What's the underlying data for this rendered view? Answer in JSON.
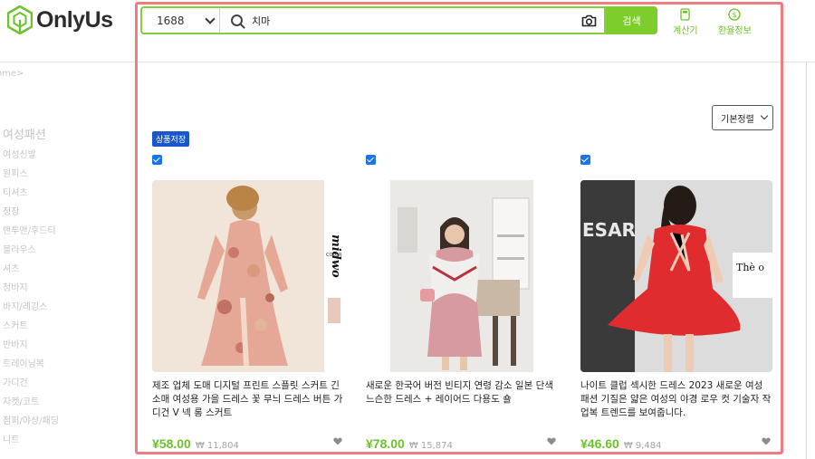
{
  "header": {
    "logo_text": "OnlyUs",
    "site_select": "1688",
    "search_value": "치마",
    "search_button": "검색",
    "tools": {
      "calculator": "계산기",
      "exchange": "환율정보"
    }
  },
  "sidebar": {
    "breadcrumb": "ome>",
    "category_title": "여성패션",
    "items": [
      "여성신발",
      "원피스",
      "티셔츠",
      "정장",
      "맨투맨/후드티",
      "블라우스",
      "셔츠",
      "청바지",
      "바지/레깅스",
      "스커트",
      "반바지",
      "트레이닝복",
      "가디건",
      "자켓/코트",
      "점퍼/야상/패딩",
      "니트"
    ]
  },
  "toolbar": {
    "sort": "기본정렬",
    "save_badge": "상품저장"
  },
  "products": [
    {
      "title": "제조 업체 도매 디지털 프린트 스플릿 스커트 긴 소매 여성용 가을 드레스 꽃 무늬 드레스 버튼 가디건 V 넥 롱 스커트",
      "price": "¥58.00",
      "krw": "₩ 11,804",
      "image_text": "midwo",
      "image_text2": "COLOR"
    },
    {
      "title": "새로운 한국어 버전 빈티지 연령 감소 일본 단색 느슨한 드레스 + 레이어드 다용도 숄",
      "price": "¥78.00",
      "krw": "₩ 15,874"
    },
    {
      "title": "나이트 클럽 섹시한 드레스 2023 새로운 여성 패션 기질은 얇은 여성의 야경 로우 컷 기술자 작업복 트렌드를 보여줍니다.",
      "price": "¥46.60",
      "krw": "₩ 9,484",
      "image_text": "ESAR",
      "image_text2": "Thè o"
    }
  ],
  "colors": {
    "brand_green": "#7dcd2c",
    "price_green": "#6cc22a",
    "badge_blue": "#1b57c9",
    "frame_red": "#f07b80"
  }
}
